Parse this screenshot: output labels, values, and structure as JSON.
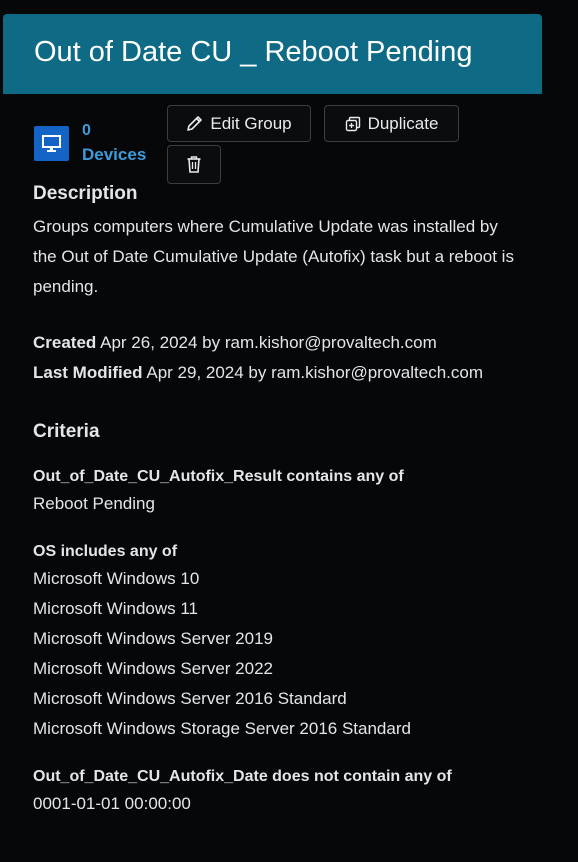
{
  "header": {
    "title": "Out of Date CU _ Reboot Pending"
  },
  "devices": {
    "count": "0",
    "label": "Devices",
    "icon": "monitor-icon"
  },
  "actions": {
    "edit_label": "Edit Group",
    "edit_icon": "pencil-icon",
    "duplicate_label": "Duplicate",
    "duplicate_icon": "duplicate-icon",
    "delete_icon": "trash-icon"
  },
  "description": {
    "heading": "Description",
    "text": "Groups computers where Cumulative Update was installed by the Out of Date Cumulative Update (Autofix) task but a reboot is pending."
  },
  "meta": {
    "created_label": "Created",
    "created_value": "Apr 26, 2024 by ram.kishor@provaltech.com",
    "modified_label": "Last Modified",
    "modified_value": "Apr 29, 2024 by ram.kishor@provaltech.com"
  },
  "criteria": {
    "heading": "Criteria",
    "groups": [
      {
        "title": "Out_of_Date_CU_Autofix_Result contains any of",
        "values": [
          "Reboot Pending"
        ]
      },
      {
        "title": "OS includes any of",
        "values": [
          "Microsoft Windows 10",
          "Microsoft Windows 11",
          "Microsoft Windows Server 2019",
          "Microsoft Windows Server 2022",
          "Microsoft Windows Server 2016 Standard",
          "Microsoft Windows Storage Server 2016 Standard"
        ]
      },
      {
        "title": "Out_of_Date_CU_Autofix_Date does not contain any of",
        "values": [
          "0001-01-01 00:00:00"
        ]
      }
    ]
  },
  "colors": {
    "header_bg": "#0e6a85",
    "device_icon_bg": "#1463c7",
    "device_link": "#3d9bdb",
    "page_bg": "#050708"
  }
}
